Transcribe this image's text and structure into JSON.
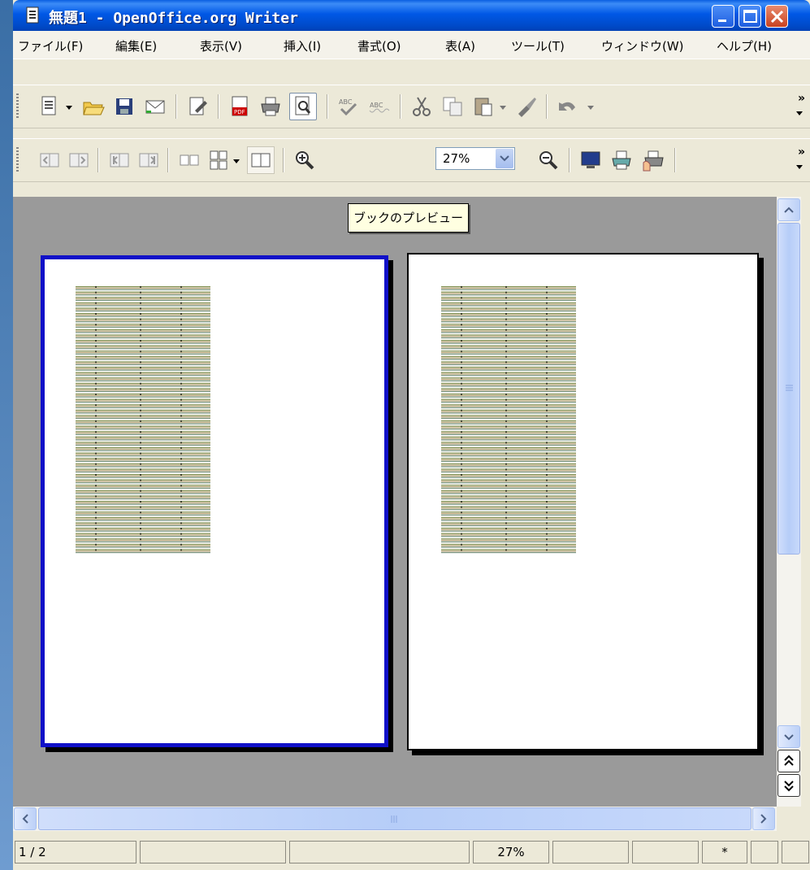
{
  "window": {
    "title": "無題1 - OpenOffice.org Writer",
    "title_color": "#ffffff",
    "titlebar_color": "#0058e6"
  },
  "menu": {
    "items": [
      "ファイル(F)",
      "編集(E)",
      "表示(V)",
      "挿入(I)",
      "書式(O)",
      "表(A)",
      "ツール(T)",
      "ウィンドウ(W)",
      "ヘルプ(H)"
    ]
  },
  "toolbar1": {
    "icons": [
      "new-document-icon",
      "open-folder-icon",
      "save-icon",
      "email-icon",
      "edit-file-icon",
      "export-pdf-icon",
      "print-icon",
      "page-preview-icon",
      "spellcheck-icon",
      "autospellcheck-icon",
      "cut-icon",
      "copy-icon",
      "paste-icon",
      "format-paintbrush-icon",
      "undo-icon"
    ],
    "overflow_label": "»"
  },
  "toolbar2": {
    "icons": [
      "previous-page-icon",
      "next-page-icon",
      "first-page-icon",
      "last-page-icon",
      "two-pages-icon",
      "multiple-pages-icon",
      "book-preview-icon",
      "zoom-in-icon",
      "zoom-out-icon",
      "full-screen-icon",
      "print-options-icon",
      "print-page-view-icon"
    ],
    "zoom_value": "27%",
    "overflow_label": "»"
  },
  "tooltip": {
    "text": "ブックのプレビュー"
  },
  "preview": {
    "background_color": "#9a9a9a",
    "selected_page_border": "#1010c8",
    "pages": 2
  },
  "status": {
    "page": "1 / 2",
    "zoom": "27%",
    "modified": "*"
  }
}
